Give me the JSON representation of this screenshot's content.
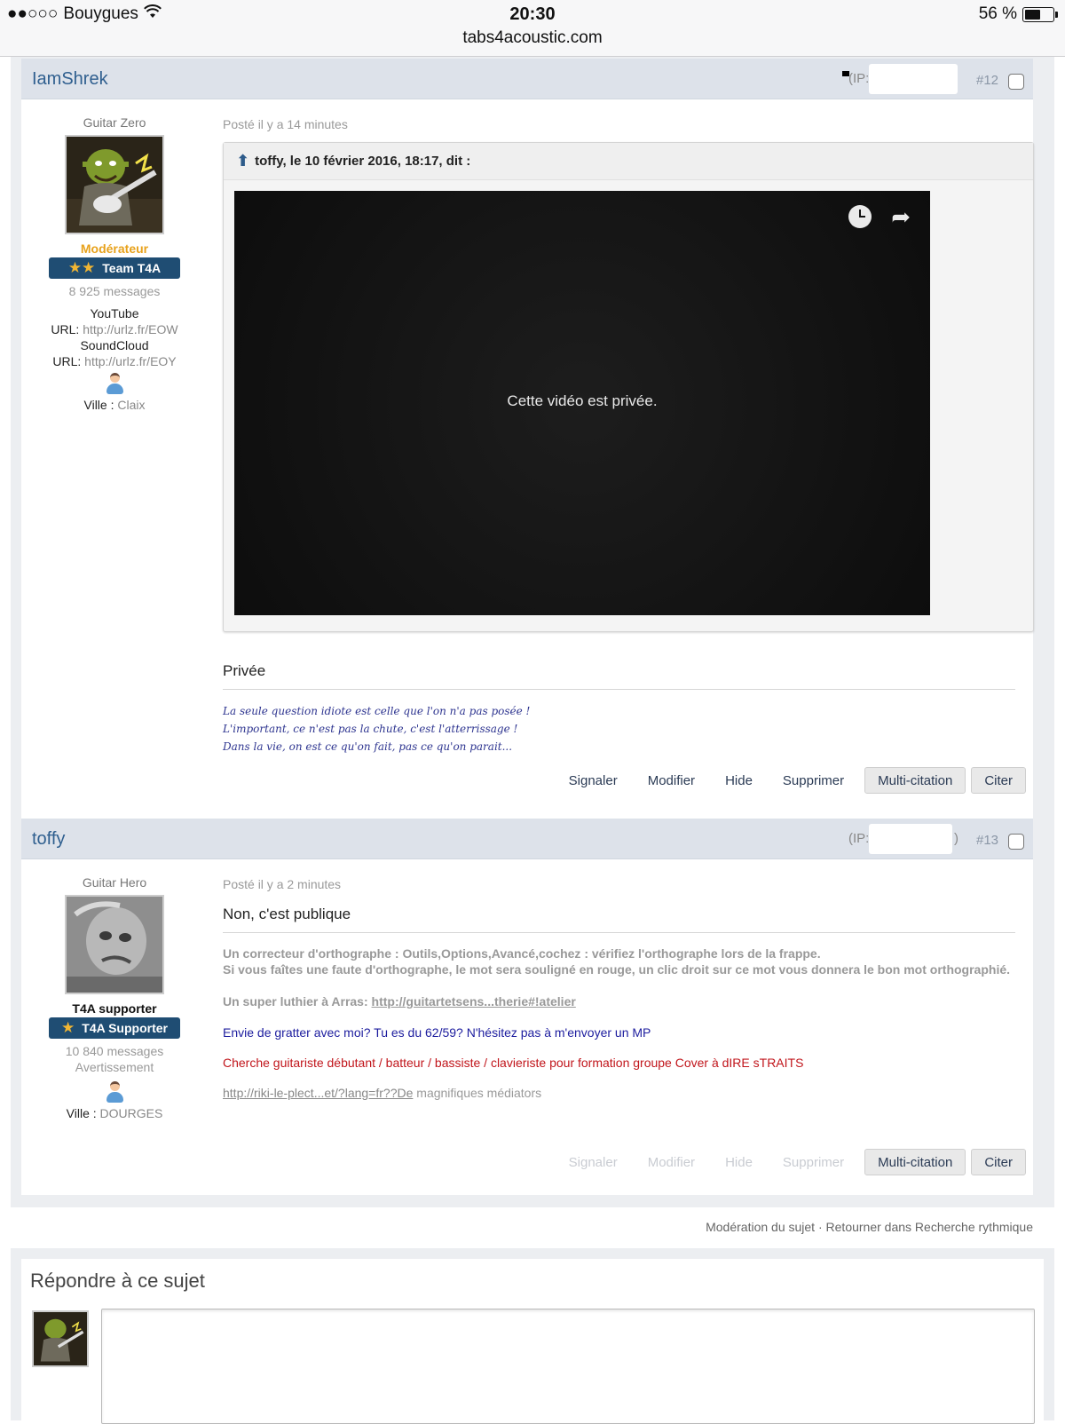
{
  "status_bar": {
    "signal": "●●○○○",
    "carrier": "Bouygues",
    "time": "20:30",
    "url": "tabs4acoustic.com",
    "battery": "56 %",
    "battery_level_percent": 56
  },
  "posts": [
    {
      "author": "IamShrek",
      "ip_label": "(IP:",
      "number": "#12",
      "rank": "Guitar Zero",
      "avatar_icon": "shrek-avatar",
      "role": "Modérateur",
      "role_color": "#e8a21c",
      "badge": "Team T4A",
      "badge_stars": "★★",
      "messages": "8 925 messages",
      "profile_lines": [
        {
          "label": "",
          "value": "YouTube"
        },
        {
          "label": "URL:",
          "value": "http://urlz.fr/EOW"
        },
        {
          "label": "",
          "value": "SoundCloud"
        },
        {
          "label": "URL:",
          "value": "http://urlz.fr/EOY"
        }
      ],
      "city_label": "Ville :",
      "city": "Claix",
      "posted": "Posté il y a 14 minutes",
      "quote_header": "toffy, le 10 février 2016, 18:17, dit :",
      "video_message": "Cette vidéo est privée.",
      "message": "Privée",
      "signature": [
        "La seule question idiote est celle que l'on n'a pas posée !",
        "L'important, ce n'est pas la chute, c'est l'atterrissage !",
        "Dans la vie, on est ce qu'on fait, pas ce qu'on parait..."
      ],
      "actions": [
        "Signaler",
        "Modifier",
        "Hide",
        "Supprimer"
      ],
      "buttons": [
        "Multi-citation",
        "Citer"
      ]
    },
    {
      "author": "toffy",
      "ip_label": "(IP:",
      "ip_close": ")",
      "number": "#13",
      "rank": "Guitar Hero",
      "avatar_icon": "grey-face-avatar",
      "role": "T4A supporter",
      "role_color": "#111111",
      "badge": "T4A Supporter",
      "badge_stars": "★",
      "messages": "10 840 messages",
      "warning": "Avertissement",
      "city_label": "Ville :",
      "city": "DOURGES",
      "posted": "Posté il y a 2 minutes",
      "message": "Non, c'est publique",
      "signature": {
        "line1": "Un correcteur d'orthographe : Outils,Options,Avancé,cochez : vérifiez l'orthographe lors de la frappe.",
        "line2": "Si vous faîtes une faute d'orthographe, le mot sera souligné en rouge, un clic droit sur ce mot vous donnera le bon mot orthographié.",
        "luthier_prefix": "Un super luthier à Arras:",
        "luthier_link": "http://guitartetsens...therie#!atelier",
        "blue_line": "Envie de gratter avec moi? Tu es du 62/59? N'hésitez pas à m'envoyer un MP",
        "red_line": "Cherche guitariste débutant / batteur / bassiste / clavieriste pour formation groupe Cover à dIRE sTRAITS",
        "riki_link": "http://riki-le-plect...et/?lang=fr??De",
        "riki_suffix": " magnifiques médiators"
      },
      "actions": [
        "Signaler",
        "Modifier",
        "Hide",
        "Supprimer"
      ],
      "buttons": [
        "Multi-citation",
        "Citer"
      ]
    }
  ],
  "footer": {
    "moderation": "Modération du sujet",
    "separator": " · ",
    "back": "Retourner dans Recherche rythmique"
  },
  "reply": {
    "title": "Répondre à ce sujet"
  },
  "colors": {
    "header_bg": "#dde2ea",
    "author_link": "#2f5f8f",
    "badge_bg": "#1f4d73",
    "signature_blue": "#2e3590",
    "signature_red": "#c1151b"
  }
}
